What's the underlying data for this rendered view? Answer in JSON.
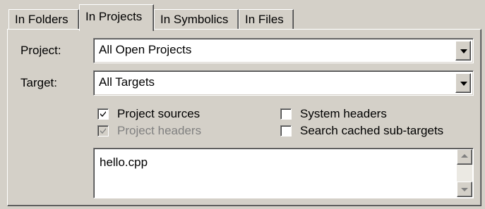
{
  "tabs": [
    {
      "label": "In Folders",
      "active": false
    },
    {
      "label": "In Projects",
      "active": true
    },
    {
      "label": "In Symbolics",
      "active": false
    },
    {
      "label": "In Files",
      "active": false
    }
  ],
  "project": {
    "label": "Project:",
    "value": "All Open Projects"
  },
  "target": {
    "label": "Target:",
    "value": "All Targets"
  },
  "checkboxes": {
    "project_sources": {
      "label": "Project sources",
      "checked": true,
      "enabled": true
    },
    "project_headers": {
      "label": "Project headers",
      "checked": true,
      "enabled": false
    },
    "system_headers": {
      "label": "System headers",
      "checked": false,
      "enabled": true
    },
    "search_cached": {
      "label": "Search cached sub-targets",
      "checked": false,
      "enabled": true
    }
  },
  "file_list": {
    "items": [
      "hello.cpp"
    ]
  },
  "colors": {
    "face": "#d4d0c8",
    "shadow": "#808080",
    "highlight": "#ffffff",
    "disabled_text": "#808080"
  }
}
